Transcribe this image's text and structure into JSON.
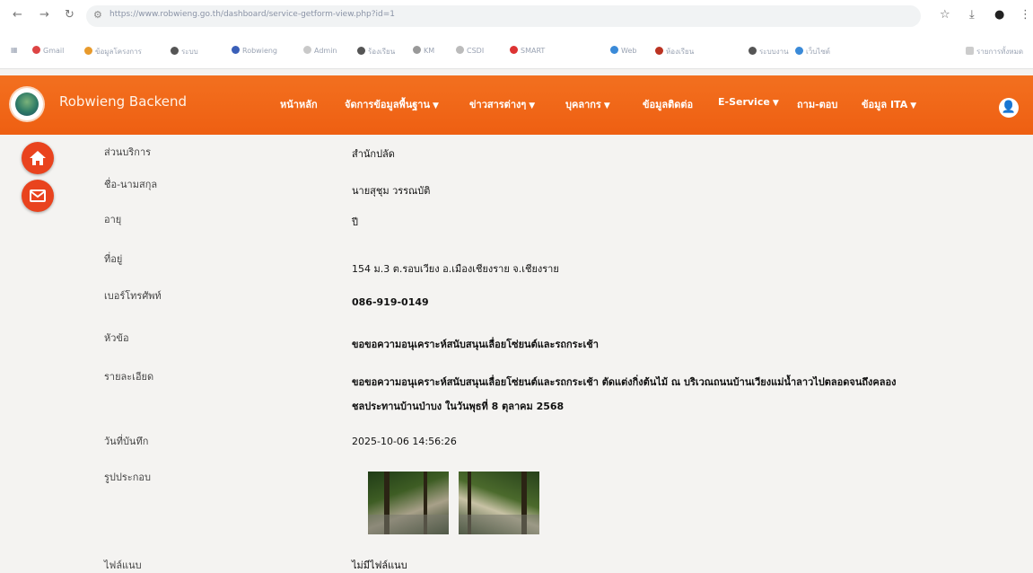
{
  "browser": {
    "url": "https://www.robwieng.go.th/dashboard/service-getform-view.php?id=1",
    "bookmarks": [
      "Gmail",
      "ข้อมูลโครงการ",
      "ระบบ",
      "Robwieng",
      "Admin",
      "ร้องเรียน",
      "KM",
      "CSDI",
      "SMART",
      "Web",
      "ห้องเรียน",
      "ระบบงาน",
      "เว็บไซต์",
      "รายการทั้งหมด"
    ]
  },
  "nav": {
    "brand": "Robwieng Backend",
    "menu": [
      {
        "label": "หน้าหลัก",
        "has_dropdown": false
      },
      {
        "label": "จัดการข้อมูลพื้นฐาน",
        "has_dropdown": true
      },
      {
        "label": "ข่าวสารต่างๆ",
        "has_dropdown": true
      },
      {
        "label": "บุคลากร",
        "has_dropdown": true
      },
      {
        "label": "ข้อมูลติดต่อ",
        "has_dropdown": false
      },
      {
        "label": "E-Service",
        "has_dropdown": true
      },
      {
        "label": "ถาม-ตอบ",
        "has_dropdown": false
      },
      {
        "label": "ข้อมูล ITA",
        "has_dropdown": true
      }
    ],
    "accent": "#ee5f12"
  },
  "details": {
    "office_label": "ส่วนบริการ",
    "office_value": "สำนักปลัด",
    "name_label": "ชื่อ-นามสกุล",
    "name_value": "นายสุชุม วรรณบัติ",
    "age_label": "อายุ",
    "age_value": "ปี",
    "address_label": "ที่อยู่",
    "address_value": "154 ม.3 ต.รอบเวียง อ.เมืองเชียงราย จ.เชียงราย",
    "phone_label": "เบอร์โทรศัพท์",
    "phone_value": "086-919-0149",
    "subject_label": "หัวข้อ",
    "subject_value": "ขอขอความอนุเคราะห์สนับสนุนเลื่อยโซ่ยนต์และรถกระเช้า",
    "detail_label": "รายละเอียด",
    "detail_line1": "ขอขอความอนุเคราะห์สนับสนุนเลื่อยโซ่ยนต์และรถกระเช้า ตัดแต่งกิ่งต้นไม้ ณ บริเวณถนนบ้านเวียงแม่น้ำลาวไปตลอดจนถึงคลอง",
    "detail_line2": "ชลประทานบ้านป่าบง ในวันพุธที่ 8 ตุลาคม 2568",
    "date_label": "วันที่บันทึก",
    "date_value": "2025-10-06 14:56:26",
    "attach_label": "รูปประกอบ",
    "file_label": "ไฟล์แนบ",
    "file_value": "ไม่มีไฟล์แนบ"
  }
}
